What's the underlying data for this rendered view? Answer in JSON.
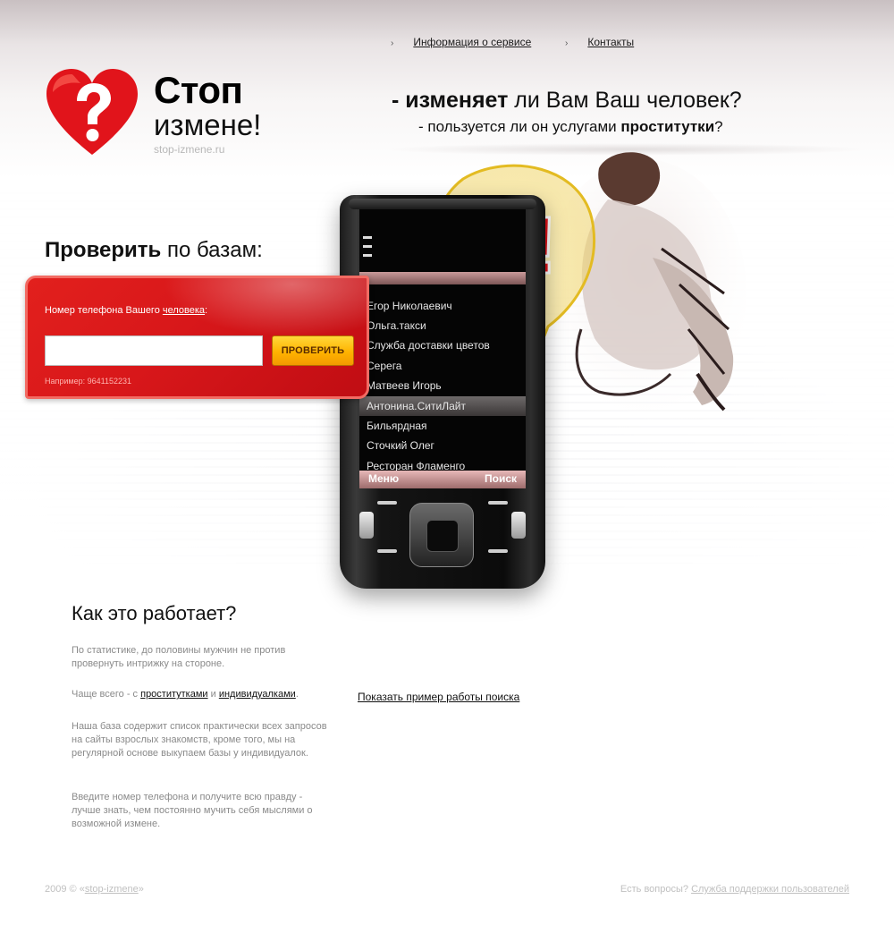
{
  "nav": {
    "items": [
      {
        "label": "Информация о сервисе"
      },
      {
        "label": "Контакты"
      }
    ],
    "arrow": "›"
  },
  "logo": {
    "icon": "heart-question-icon",
    "title": "Стоп",
    "subtitle": "измене!",
    "domain": "stop-izmene.ru"
  },
  "headline": {
    "line1_prefix": "- ",
    "line1_bold": "изменяет",
    "line1_rest": " ли Вам Ваш человек?",
    "line2_prefix": "- пользуется ли он услугами ",
    "line2_bold": "проститутки",
    "line2_suffix": "?"
  },
  "form": {
    "title_bold": "Проверить",
    "title_rest": " по базам:",
    "label_text": "Номер телефона Вашего ",
    "label_link": "человека",
    "label_colon": ":",
    "input_value": "",
    "input_placeholder": "",
    "button_label": "ПРОВЕРИТЬ",
    "example": "Например: 9641152231"
  },
  "phone": {
    "contacts": [
      "Егор Николаевич",
      "Ольга.такси",
      "Служба доставки цветов",
      "Серега",
      "Матвеев Игорь",
      "Антонина.СитиЛайт",
      "Бильярдная",
      "Сточкий Олег",
      "Ресторан Фламенго"
    ],
    "selected_index": 5,
    "softkey_left": "Меню",
    "softkey_right": "Поиск"
  },
  "bubble": {
    "text": "?!"
  },
  "how": {
    "title": "Как это работает?",
    "p1": "По статистике, до половины мужчин не против провернуть интрижку на стороне.",
    "p2_prefix": "Чаще всего - с ",
    "p2_link1": "проститутками",
    "p2_mid": " и ",
    "p2_link2": "индивидуалками",
    "p2_suffix": ".",
    "p3": "Наша база содержит список практически всех запросов на сайты взрослых знакомств, кроме того, мы на регулярной основе выкупаем базы у индивидуалок.",
    "p4": "Введите номер телефона и получите всю правду - лучше знать, чем постоянно мучить себя мыслями о возможной измене.",
    "demo_link": "Показать пример работы поиска"
  },
  "footer": {
    "copyright_prefix": "2009 © «",
    "copyright_link": "stop-izmene",
    "copyright_suffix": "»",
    "questions": "Есть вопросы? ",
    "support_link": "Служба поддержки пользователей"
  },
  "colors": {
    "brand_red": "#d8171a",
    "button_yellow": "#ffb300",
    "bubble_yellow": "#e9c334"
  }
}
